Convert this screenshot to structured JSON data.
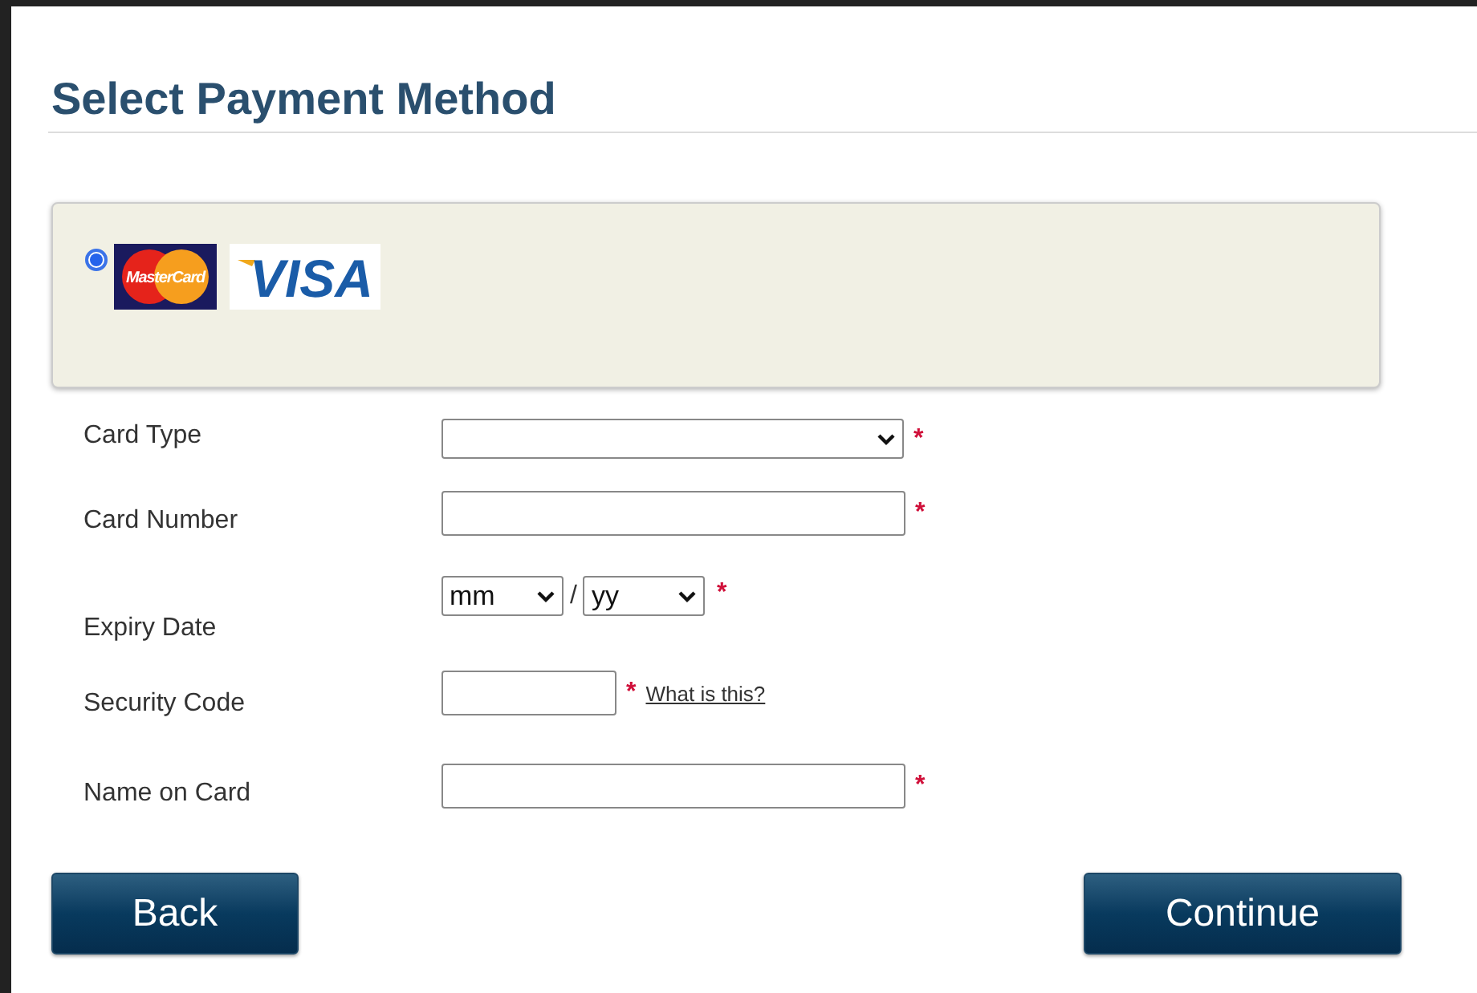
{
  "title": "Select Payment Method",
  "payment_option": {
    "selected": true,
    "logos": [
      {
        "kind": "mastercard",
        "text": "MasterCard"
      },
      {
        "kind": "visa",
        "text": "VISA"
      }
    ]
  },
  "fields": [
    {
      "kind": "select",
      "label": "Card Type",
      "required": true,
      "required_mark": "*"
    },
    {
      "kind": "text",
      "label": "Card Number",
      "required": true,
      "required_mark": "*"
    },
    {
      "kind": "expiry",
      "label": "Expiry Date",
      "month": "mm",
      "separator": "/",
      "year": "yy",
      "required": true,
      "required_mark": "*"
    },
    {
      "kind": "short",
      "label": "Security Code",
      "required": true,
      "required_mark": "*",
      "link": "What is this?"
    },
    {
      "kind": "text",
      "label": "Name on Card",
      "required": true,
      "required_mark": "*"
    }
  ],
  "buttons": [
    {
      "label": "Back"
    },
    {
      "label": "Continue"
    }
  ]
}
